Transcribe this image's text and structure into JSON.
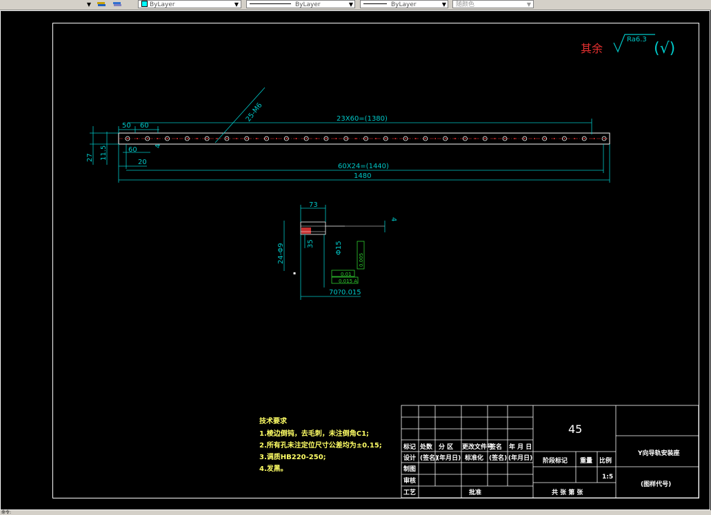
{
  "toolbar": {
    "layer_combo": "ByLayer",
    "linetype_combo": "ByLayer",
    "lineweight_combo": "ByLayer",
    "color_combo": "随颜色"
  },
  "drawing": {
    "roughness_prefix": "其余",
    "roughness_value": "Ra6.3",
    "roughness_paren": "(√)",
    "rail": {
      "dim_top_spacing": "23X60=(1380)",
      "dim_50": "50",
      "dim_60_top": "60",
      "dim_60_left": "60",
      "dim_4": "4",
      "dim_20": "20",
      "dim_27": "27",
      "dim_11_5": "11.5",
      "dim_bottom_spacing": "60X24=(1440)",
      "dim_total": "1480",
      "hole_note": "25-M6"
    },
    "section": {
      "dim_73": "73",
      "dim_35": "35",
      "dim_24": "24-Φ9",
      "dim_phi15": "Φ15",
      "dim_70": "70?0.015",
      "tol_1": "0.01",
      "tol_2": "0.015 A",
      "dim_4": "4",
      "dim_side": "0.005"
    },
    "tech_req": {
      "title": "技术要求",
      "line1": "1.棱边倒钝，去毛刺，未注倒角C1;",
      "line2": "2.所有孔未注定位尺寸公差均为±0.15;",
      "line3": "3.调质HB220-250;",
      "line4": "4.发黑。"
    },
    "title_block": {
      "material": "45",
      "part_name": "Y向导轨安装座",
      "drawing_code": "(图样代号)",
      "scale": "1:5",
      "stage_mark": "阶段标记",
      "weight": "重量",
      "ratio": "比例",
      "sheets": "共  张  第  张",
      "row_mark": "标记",
      "row_count": "处数",
      "row_zone": "分 区",
      "row_docno": "更改文件号",
      "row_sign": "签名",
      "row_date": "年 月 日",
      "design": "设计",
      "sign_a": "(签名)",
      "date_a": "(年月日)",
      "standard": "标准化",
      "sign_b": "(签名)",
      "date_b": "(年月日)",
      "drafter": "制图",
      "review": "审核",
      "process": "工艺",
      "approve": "批准"
    }
  },
  "status": {
    "text": "命令:"
  }
}
